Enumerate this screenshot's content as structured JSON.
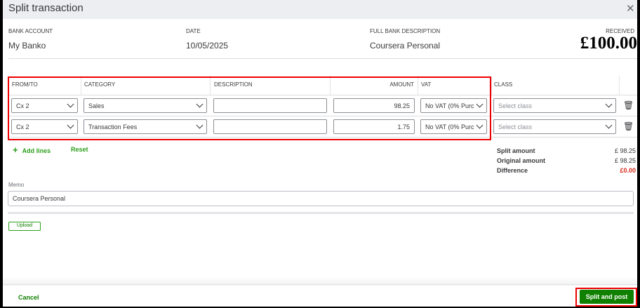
{
  "dialog": {
    "title": "Split transaction",
    "close_icon": "close-icon"
  },
  "info": {
    "bank_account_label": "BANK ACCOUNT",
    "bank_account": "My Banko",
    "date_label": "DATE",
    "date": "10/05/2025",
    "description_label": "FULL BANK DESCRIPTION",
    "description": "Coursera Personal",
    "received_label": "RECEIVED",
    "received": "£100.00"
  },
  "table": {
    "headers": [
      "FROM/TO",
      "CATEGORY",
      "DESCRIPTION",
      "AMOUNT",
      "VAT",
      "CLASS"
    ],
    "rows": [
      {
        "from_to": "Cx 2",
        "category": "Sales",
        "description": "",
        "amount": "98.25",
        "vat": "No VAT (0% Purc",
        "class_placeholder": "Select class"
      },
      {
        "from_to": "Cx 2",
        "category": "Transaction Fees",
        "description": "",
        "amount": "1.75",
        "vat": "No VAT (0% Purc",
        "class_placeholder": "Select class"
      }
    ]
  },
  "actions": {
    "add_lines": "Add lines",
    "reset": "Reset"
  },
  "summary": {
    "split_label": "Split amount",
    "split": "£ 98.25",
    "original_label": "Original amount",
    "original": "£ 98.25",
    "difference_label": "Difference",
    "difference": "£0.00"
  },
  "memo": {
    "label": "Memo",
    "value": "Coursera Personal"
  },
  "upload": "Upload",
  "footer": {
    "cancel": "Cancel",
    "submit": "Split and post"
  },
  "colors": {
    "accent": "#2ca01c",
    "primary_button": "#108000",
    "difference": "#d52b1e",
    "highlight": "#ee0000"
  }
}
